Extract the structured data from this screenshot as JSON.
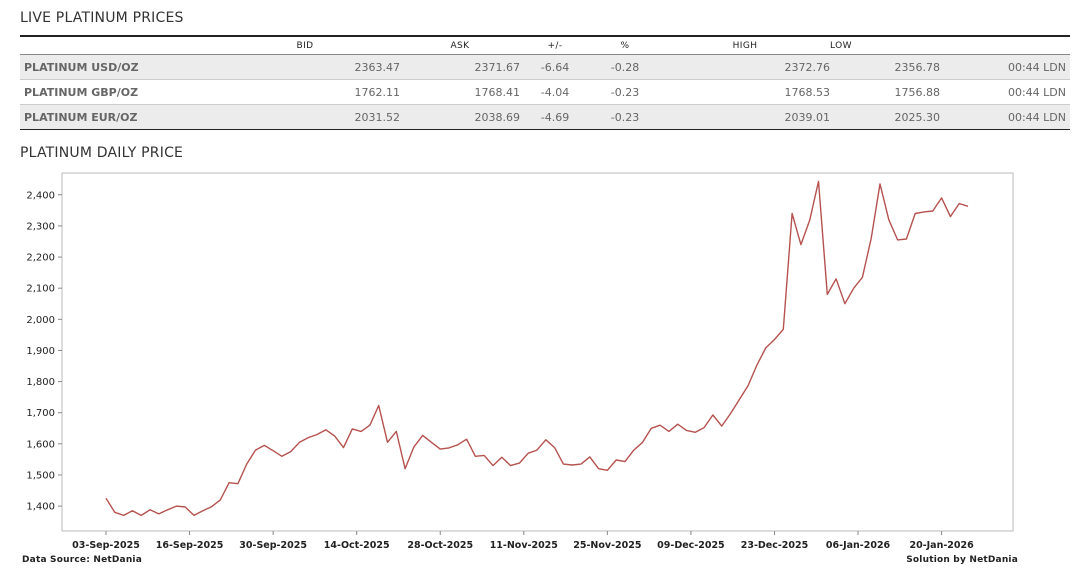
{
  "live_title": "LIVE PLATINUM PRICES",
  "daily_title": "PLATINUM DAILY PRICE",
  "table": {
    "headers": [
      "",
      "BID",
      "ASK",
      "+/-",
      "%",
      "HIGH",
      "LOW",
      ""
    ],
    "rows": [
      {
        "name": "PLATINUM USD/OZ",
        "bid": "2363.47",
        "ask": "2371.67",
        "change": "-6.64",
        "pct": "-0.28",
        "high": "2372.76",
        "low": "2356.78",
        "time": "00:44 LDN"
      },
      {
        "name": "PLATINUM GBP/OZ",
        "bid": "1762.11",
        "ask": "1768.41",
        "change": "-4.04",
        "pct": "-0.23",
        "high": "1768.53",
        "low": "1756.88",
        "time": "00:44 LDN"
      },
      {
        "name": "PLATINUM EUR/OZ",
        "bid": "2031.52",
        "ask": "2038.69",
        "change": "-4.69",
        "pct": "-0.23",
        "high": "2039.01",
        "low": "2025.30",
        "time": "00:44 LDN"
      }
    ]
  },
  "footer": {
    "source": "Data Source: NetDania",
    "solution": "Solution by NetDania"
  },
  "colors": {
    "line": "#b5524f",
    "negative": "#c0504d"
  },
  "chart_data": {
    "type": "line",
    "title": "",
    "xlabel": "",
    "ylabel": "",
    "ylim": [
      1320,
      2470
    ],
    "yticks": [
      1400,
      1500,
      1600,
      1700,
      1800,
      1900,
      2000,
      2100,
      2200,
      2300,
      2400
    ],
    "ytick_labels": [
      "1,400",
      "1,500",
      "1,600",
      "1,700",
      "1,800",
      "1,900",
      "2,000",
      "2,100",
      "2,200",
      "2,300",
      "2,400"
    ],
    "xtick_labels": [
      "03-Sep-2025",
      "16-Sep-2025",
      "30-Sep-2025",
      "14-Oct-2025",
      "28-Oct-2025",
      "11-Nov-2025",
      "25-Nov-2025",
      "09-Dec-2025",
      "23-Dec-2025",
      "06-Jan-2026",
      "20-Jan-2026"
    ],
    "xtick_positions": [
      0,
      9.5,
      19,
      28.5,
      38,
      47.5,
      57,
      66.5,
      76,
      85.5,
      95
    ],
    "grid": false,
    "series": [
      {
        "values": [
          1425,
          1380,
          1370,
          1385,
          1370,
          1388,
          1375,
          1388,
          1400,
          1397,
          1370,
          1385,
          1398,
          1420,
          1475,
          1472,
          1535,
          1580,
          1595,
          1578,
          1560,
          1575,
          1605,
          1620,
          1630,
          1645,
          1625,
          1588,
          1648,
          1640,
          1660,
          1723,
          1605,
          1640,
          1520,
          1590,
          1627,
          1605,
          1583,
          1587,
          1597,
          1615,
          1560,
          1563,
          1530,
          1557,
          1530,
          1538,
          1570,
          1580,
          1613,
          1588,
          1535,
          1532,
          1535,
          1558,
          1520,
          1515,
          1548,
          1543,
          1580,
          1605,
          1650,
          1660,
          1640,
          1663,
          1643,
          1637,
          1652,
          1693,
          1657,
          1697,
          1742,
          1787,
          1853,
          1908,
          1935,
          1968,
          2340,
          2240,
          2318,
          2443,
          2080,
          2130,
          2050,
          2100,
          2135,
          2260,
          2435,
          2320,
          2255,
          2258,
          2340,
          2345,
          2348,
          2390,
          2330,
          2372,
          2363
        ]
      }
    ]
  }
}
